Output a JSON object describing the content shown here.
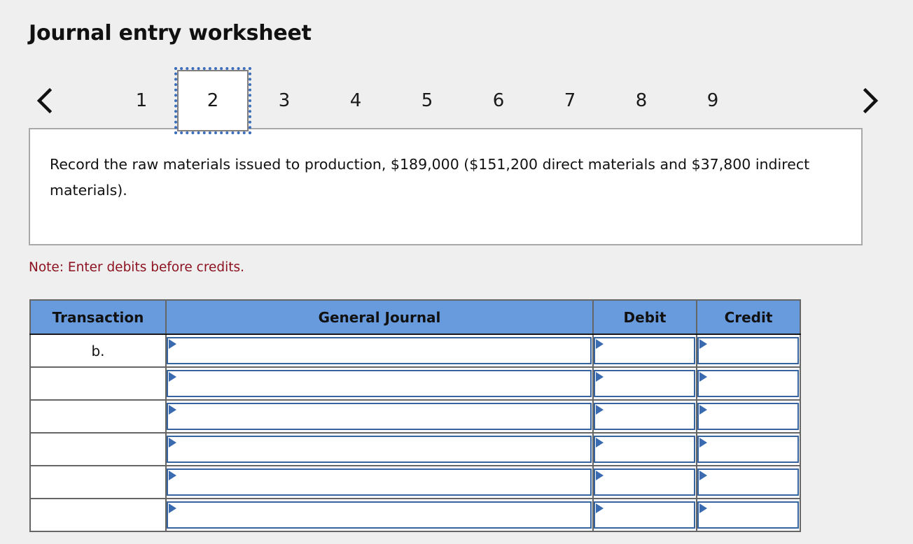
{
  "page": {
    "title": "Journal entry worksheet"
  },
  "pager": {
    "prev_icon": "chevron-left-icon",
    "next_icon": "chevron-right-icon",
    "active_tab": "2",
    "tabs": [
      {
        "label": "1",
        "active": false
      },
      {
        "label": "2",
        "active": true
      },
      {
        "label": "3",
        "active": false
      },
      {
        "label": "4",
        "active": false
      },
      {
        "label": "5",
        "active": false
      },
      {
        "label": "6",
        "active": false
      },
      {
        "label": "7",
        "active": false
      },
      {
        "label": "8",
        "active": false
      },
      {
        "label": "9",
        "active": false
      }
    ]
  },
  "instruction": {
    "text": "Record the raw materials issued to production, $189,000 ($151,200 direct materials and $37,800 indirect materials)."
  },
  "note": {
    "text": "Note: Enter debits before credits."
  },
  "table": {
    "headers": {
      "transaction": "Transaction",
      "general_journal": "General Journal",
      "debit": "Debit",
      "credit": "Credit"
    },
    "rows": [
      {
        "transaction": "b.",
        "general_journal": "",
        "debit": "",
        "credit": ""
      },
      {
        "transaction": "",
        "general_journal": "",
        "debit": "",
        "credit": ""
      },
      {
        "transaction": "",
        "general_journal": "",
        "debit": "",
        "credit": ""
      },
      {
        "transaction": "",
        "general_journal": "",
        "debit": "",
        "credit": ""
      },
      {
        "transaction": "",
        "general_journal": "",
        "debit": "",
        "credit": ""
      },
      {
        "transaction": "",
        "general_journal": "",
        "debit": "",
        "credit": ""
      }
    ]
  },
  "colors": {
    "page_background": "#efefef",
    "header_blue": "#689bde",
    "input_border_blue": "#36649f",
    "marker_blue": "#3a6ab0",
    "note_red": "#8c1220",
    "focus_outline_blue": "#3b6fba",
    "panel_border_gray": "#a9a9a9",
    "table_border_gray": "#666666"
  }
}
